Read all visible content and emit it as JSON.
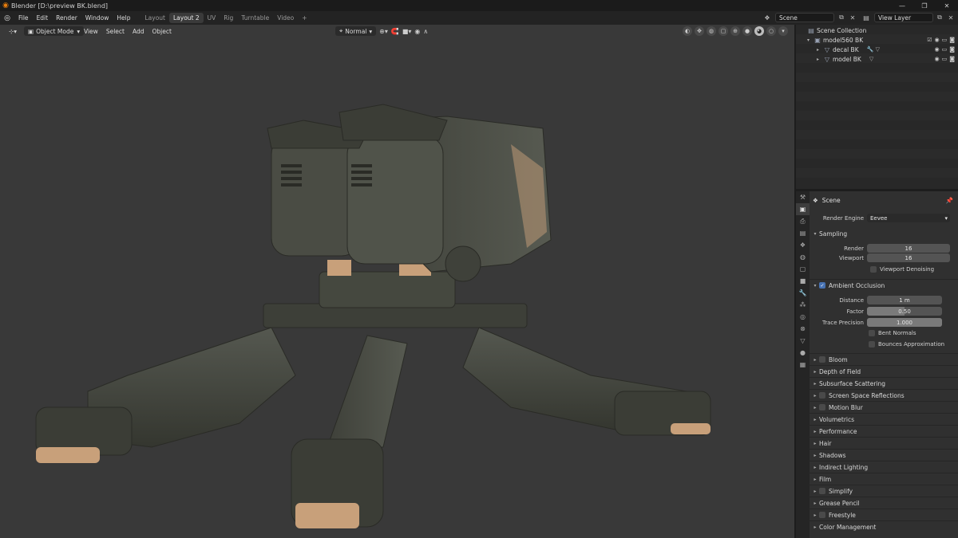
{
  "window": {
    "title": "Blender [D:\\preview BK.blend]",
    "minimize": "—",
    "maximize": "❐",
    "close": "✕"
  },
  "menu": [
    "File",
    "Edit",
    "Render",
    "Window",
    "Help"
  ],
  "workspaces": [
    "Layout",
    "Layout 2",
    "UV",
    "Rig",
    "Turntable",
    "Video"
  ],
  "active_workspace": "Layout 2",
  "workspace_add": "+",
  "scene_field": "Scene",
  "view_layer_field": "View Layer",
  "viewport": {
    "mode": "Object Mode",
    "menus": [
      "View",
      "Select",
      "Add",
      "Object"
    ],
    "orientation": "Normal"
  },
  "outliner": {
    "root": "Scene Collection",
    "items": [
      {
        "label": "model560 BK",
        "depth": 1
      },
      {
        "label": "decal BK",
        "depth": 2
      },
      {
        "label": "model BK",
        "depth": 2
      }
    ]
  },
  "properties": {
    "context": "Scene",
    "render_engine_label": "Render Engine",
    "render_engine": "Eevee",
    "sampling": {
      "title": "Sampling",
      "render_label": "Render",
      "render": "16",
      "viewport_label": "Viewport",
      "viewport": "16",
      "denoise_label": "Viewport Denoising"
    },
    "ao": {
      "title": "Ambient Occlusion",
      "distance_label": "Distance",
      "distance": "1 m",
      "factor_label": "Factor",
      "factor": "0.50",
      "factor_value": 0.5,
      "trace_label": "Trace Precision",
      "trace": "1.000",
      "trace_value": 1.0,
      "bent_label": "Bent Normals",
      "bounce_label": "Bounces Approximation"
    },
    "panels": [
      {
        "label": "Bloom",
        "checkbox": true
      },
      {
        "label": "Depth of Field",
        "checkbox": false
      },
      {
        "label": "Subsurface Scattering",
        "checkbox": false
      },
      {
        "label": "Screen Space Reflections",
        "checkbox": true
      },
      {
        "label": "Motion Blur",
        "checkbox": true
      },
      {
        "label": "Volumetrics",
        "checkbox": false
      },
      {
        "label": "Performance",
        "checkbox": false
      },
      {
        "label": "Hair",
        "checkbox": false
      },
      {
        "label": "Shadows",
        "checkbox": false
      },
      {
        "label": "Indirect Lighting",
        "checkbox": false
      },
      {
        "label": "Film",
        "checkbox": false
      },
      {
        "label": "Simplify",
        "checkbox": true
      },
      {
        "label": "Grease Pencil",
        "checkbox": false
      },
      {
        "label": "Freestyle",
        "checkbox": true
      },
      {
        "label": "Color Management",
        "checkbox": false
      }
    ]
  },
  "colors": {
    "accent": "#4772b3",
    "viewport_bg": "#393939",
    "model": "#45483f",
    "tan": "#c8a07a"
  }
}
